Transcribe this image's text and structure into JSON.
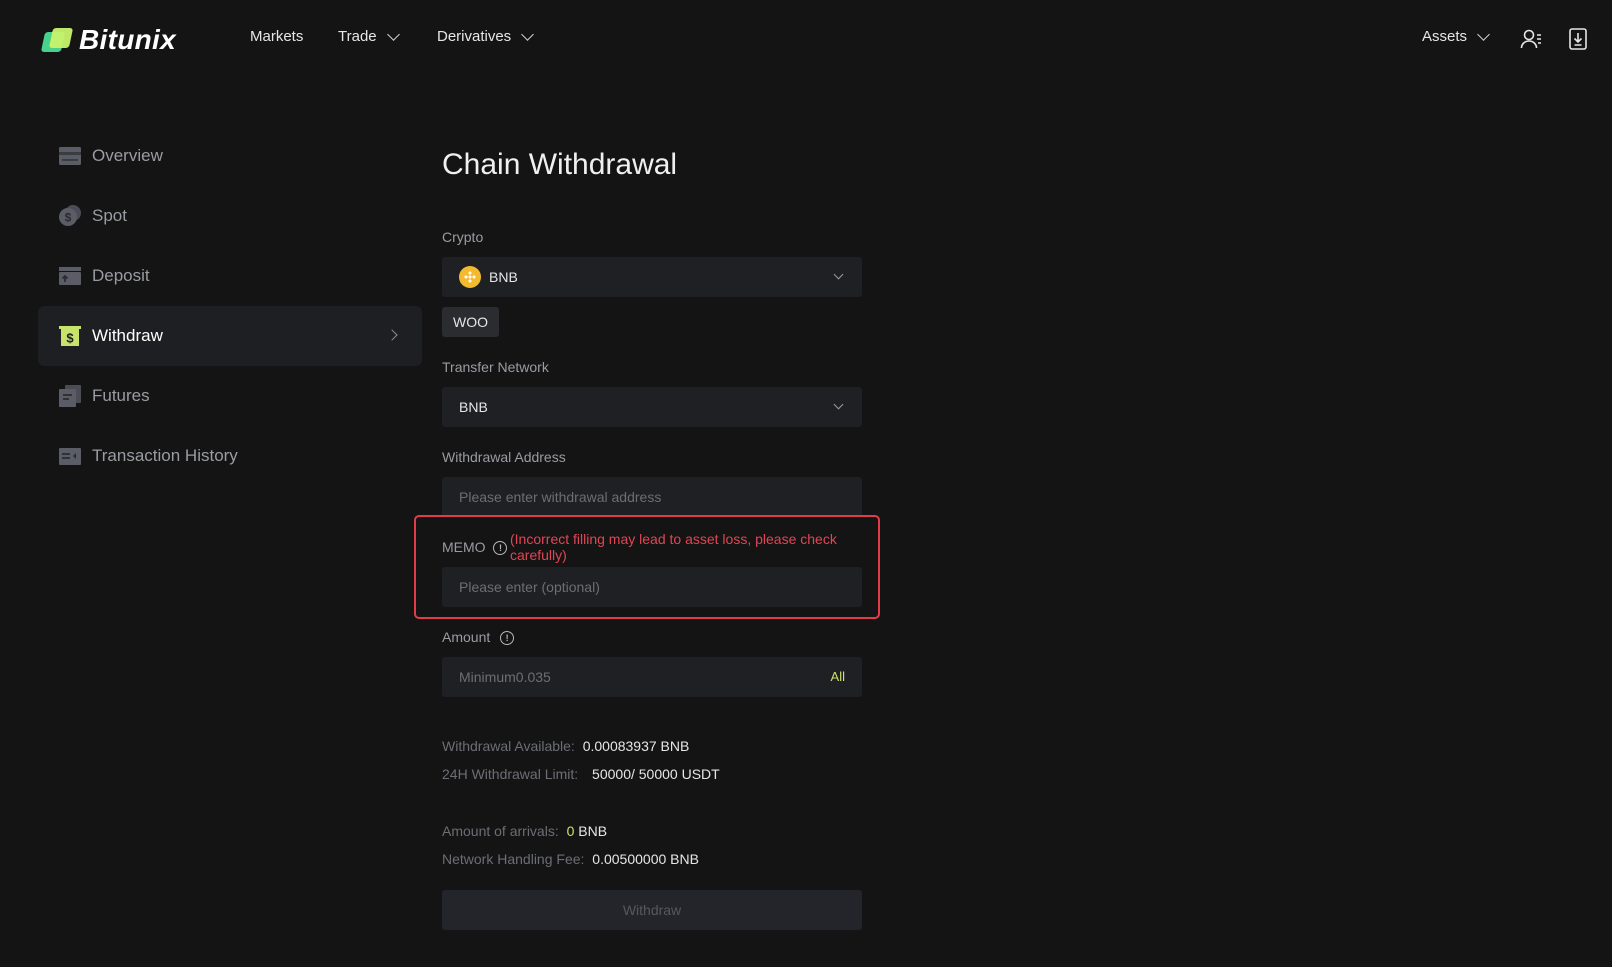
{
  "brand": {
    "name": "Bitunix"
  },
  "nav": {
    "items": [
      {
        "label": "Markets"
      },
      {
        "label": "Trade"
      },
      {
        "label": "Derivatives"
      }
    ],
    "assets_label": "Assets"
  },
  "sidebar": {
    "items": [
      {
        "label": "Overview",
        "icon": "wallet-card-icon"
      },
      {
        "label": "Spot",
        "icon": "coins-icon"
      },
      {
        "label": "Deposit",
        "icon": "deposit-icon"
      },
      {
        "label": "Withdraw",
        "icon": "withdraw-icon",
        "active": true
      },
      {
        "label": "Futures",
        "icon": "futures-icon"
      },
      {
        "label": "Transaction History",
        "icon": "history-icon"
      }
    ]
  },
  "form": {
    "title": "Chain Withdrawal",
    "crypto_label": "Crypto",
    "crypto_value": "BNB",
    "recent_tag": "WOO",
    "network_label": "Transfer Network",
    "network_value": "BNB",
    "address_label": "Withdrawal Address",
    "address_placeholder": "Please enter withdrawal address",
    "memo_label": "MEMO",
    "memo_warning": "(Incorrect filling may lead to asset loss, please check carefully)",
    "memo_placeholder": "Please enter (optional)",
    "amount_label": "Amount",
    "amount_placeholder": "Minimum0.035",
    "all_label": "All",
    "available_label": "Withdrawal Available:",
    "available_value": "0.00083937 BNB",
    "limit_label": "24H Withdrawal Limit:",
    "limit_value": "50000/ 50000 USDT",
    "arrivals_label": "Amount of arrivals:",
    "arrivals_amount": "0",
    "arrivals_unit": "BNB",
    "fee_label": "Network Handling Fee:",
    "fee_value": "0.00500000 BNB",
    "submit_label": "Withdraw"
  },
  "colors": {
    "background": "#141414",
    "accent": "#c7e36b",
    "warning": "#e04654",
    "highlight_border": "#e23b4a"
  }
}
